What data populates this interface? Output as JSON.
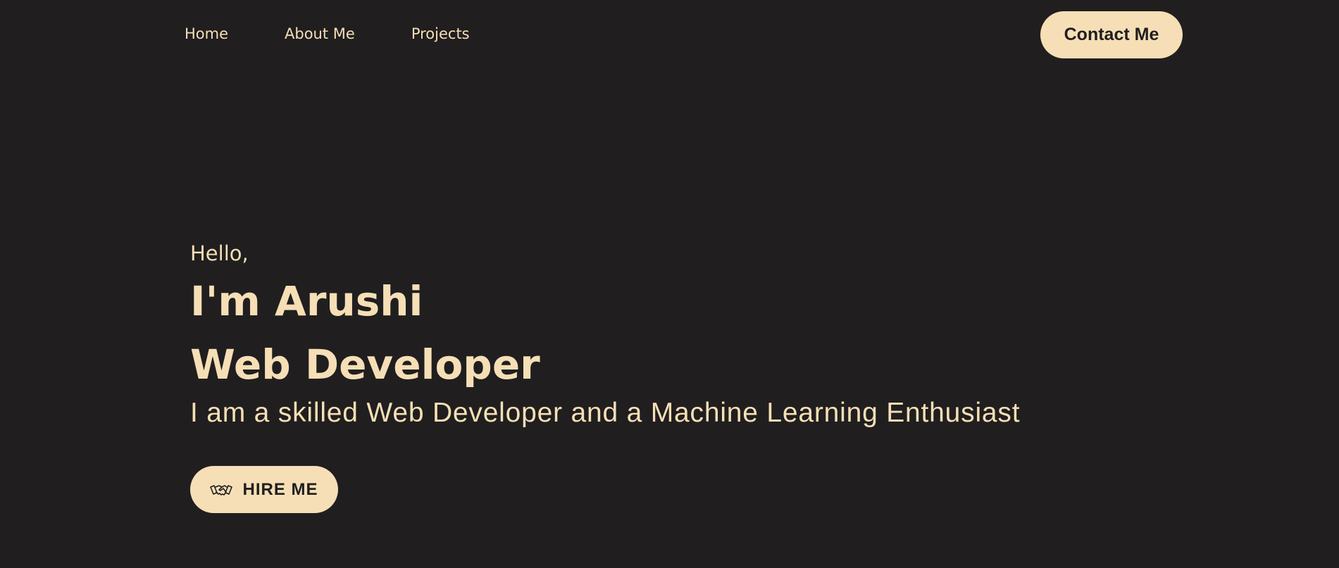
{
  "nav": {
    "links": [
      {
        "label": "Home"
      },
      {
        "label": "About Me"
      },
      {
        "label": "Projects"
      }
    ],
    "contact_label": "Contact Me"
  },
  "hero": {
    "greeting": "Hello,",
    "name": "I'm Arushi",
    "role": "Web Developer",
    "tagline": "I am a skilled Web Developer and a Machine Learning Enthusiast",
    "hire_label": "HIRE ME",
    "hire_icon": "handshake-icon"
  },
  "colors": {
    "background": "#201e1f",
    "accent": "#f6dfb6",
    "button_text": "#201e1f"
  }
}
